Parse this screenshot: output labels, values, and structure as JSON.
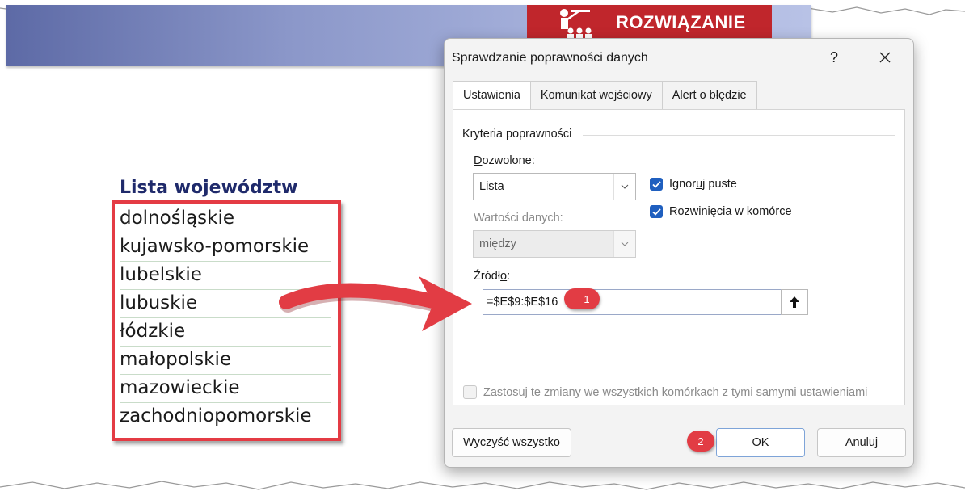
{
  "header": {
    "solution_label": "ROZWIĄZANIE",
    "band_color": "#8b97c9",
    "badge_color": "#c0262c",
    "badge_icon": "teacher-icon"
  },
  "province_list": {
    "title": "Lista województw",
    "items": [
      "dolnośląskie",
      "kujawsko-pomorskie",
      "lubelskie",
      "lubuskie",
      "łódzkie",
      "małopolskie",
      "mazowieckie",
      "zachodniopomorskie"
    ],
    "highlight_color": "#e43b44"
  },
  "dialog": {
    "title": "Sprawdzanie poprawności danych",
    "help_label": "?",
    "close_label": "✕",
    "tabs": [
      {
        "label": "Ustawienia",
        "active": true
      },
      {
        "label": "Komunikat wejściowy",
        "active": false
      },
      {
        "label": "Alert o błędzie",
        "active": false
      }
    ],
    "criteria_group": "Kryteria poprawności",
    "allow": {
      "label_pre": "",
      "label_u": "D",
      "label_post": "ozwolone:",
      "value": "Lista"
    },
    "data": {
      "label": "Wartości danych:",
      "value": "między"
    },
    "ignore_blank": {
      "label_pre": "Ignor",
      "label_u": "u",
      "label_post": "j puste",
      "checked": true
    },
    "in_cell_dropdown": {
      "label_pre": "",
      "label_u": "R",
      "label_post": "ozwinięcia w komórce",
      "checked": true
    },
    "source": {
      "label_pre": "Źródł",
      "label_u": "o",
      "label_post": ":",
      "value": "=$E$9:$E$16",
      "button_icon": "collapse-arrow-up-icon"
    },
    "apply_all": {
      "label": "Zastosuj te zmiany we wszystkich komórkach z tymi samymi ustawieniami",
      "checked": false
    },
    "clear_button": {
      "label_pre": "Wy",
      "label_u": "c",
      "label_post": "zyść wszystko"
    },
    "ok_label": "OK",
    "cancel_label": "Anuluj"
  },
  "markers": {
    "step1": "1",
    "step2": "2",
    "color": "#e23c44"
  }
}
